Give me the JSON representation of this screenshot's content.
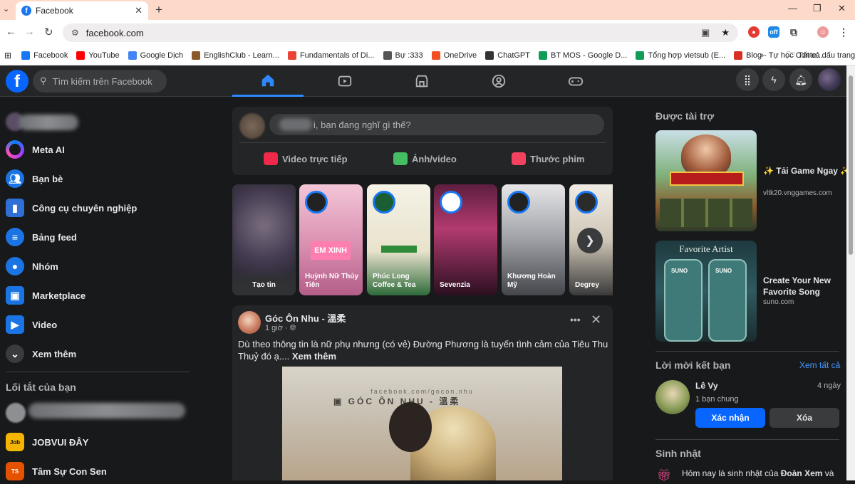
{
  "browser": {
    "tab_title": "Facebook",
    "url": "facebook.com",
    "bookmarks": [
      {
        "label": "Facebook",
        "color": "#1877f2"
      },
      {
        "label": "YouTube",
        "color": "#ff0000"
      },
      {
        "label": "Google Dịch",
        "color": "#4285f4"
      },
      {
        "label": "EnglishClub - Learn...",
        "color": "#8a5a2b"
      },
      {
        "label": "Fundamentals of Di...",
        "color": "#ea4335"
      },
      {
        "label": "Bự :333",
        "color": "#555555"
      },
      {
        "label": "OneDrive",
        "color": "#f25022"
      },
      {
        "label": "ChatGPT",
        "color": "#333333"
      },
      {
        "label": "BT MOS - Google D...",
        "color": "#0f9d58"
      },
      {
        "label": "Tổng hợp vietsub (E...",
        "color": "#0f9d58"
      },
      {
        "label": "Blog - Tự học Conte...",
        "color": "#d93025"
      }
    ],
    "bookmarks_more": "»",
    "all_bookmarks": "Tất cả dấu trang"
  },
  "fb": {
    "search_placeholder": "Tìm kiếm trên Facebook",
    "sidebar": [
      {
        "label": "Meta AI",
        "icon": "meta-ai-icon"
      },
      {
        "label": "Bạn bè",
        "icon": "friends-icon"
      },
      {
        "label": "Công cụ chuyên nghiệp",
        "icon": "professional-tools-icon"
      },
      {
        "label": "Bảng feed",
        "icon": "feed-icon"
      },
      {
        "label": "Nhóm",
        "icon": "groups-icon"
      },
      {
        "label": "Marketplace",
        "icon": "marketplace-icon"
      },
      {
        "label": "Video",
        "icon": "video-icon"
      },
      {
        "label": "Xem thêm",
        "icon": "chevron-down-icon"
      }
    ],
    "shortcuts_title": "Lối tắt của bạn",
    "shortcuts": [
      {
        "label": "JOBVUI ĐÂY"
      },
      {
        "label": "Tâm Sự Con Sen"
      }
    ],
    "composer": {
      "placeholder": "i, bạn đang nghĩ gì thế?",
      "actions": [
        "Video trực tiếp",
        "Ảnh/video",
        "Thước phim"
      ]
    },
    "stories": [
      {
        "label": "Tạo tin"
      },
      {
        "label": "Huỳnh Nữ Thủy Tiên"
      },
      {
        "label": "Phúc Long Coffee & Tea"
      },
      {
        "label": "Sevenzia"
      },
      {
        "label": "Khương Hoàn Mỹ"
      },
      {
        "label": "Degrey"
      }
    ],
    "post": {
      "author": "Góc Ôn Nhu - 溫柔",
      "time": "1 giờ ·",
      "text": "Dù theo thông tin là nữ phụ nhưng (có vẻ) Đường Phương là tuyến tình cảm của Tiêu Thu Thuỷ đó ạ....",
      "see_more": "Xem thêm",
      "image_watermark": "GÓC ÔN NHU - 溫柔",
      "image_url_text": "facebook.com/gocon.nhu"
    },
    "right": {
      "sponsored_title": "Được tài trợ",
      "ads": [
        {
          "title": "✨ Tải Game Ngay ✨",
          "domain": "vltk20.vnggames.com"
        },
        {
          "title": "Create Your New Favorite Song",
          "domain": "suno.com"
        }
      ],
      "friend_requests_title": "Lời mời kết bạn",
      "see_all": "Xem tất cả",
      "request": {
        "name": "Lê Vy",
        "mutual": "1 bạn chung",
        "time": "4 ngày",
        "confirm": "Xác nhận",
        "delete": "Xóa"
      },
      "birthdays_title": "Sinh nhật",
      "birthday_text_prefix": "Hôm nay là sinh nhật của ",
      "birthday_name": "Đoàn Xem",
      "birthday_text_suffix": " và"
    }
  }
}
